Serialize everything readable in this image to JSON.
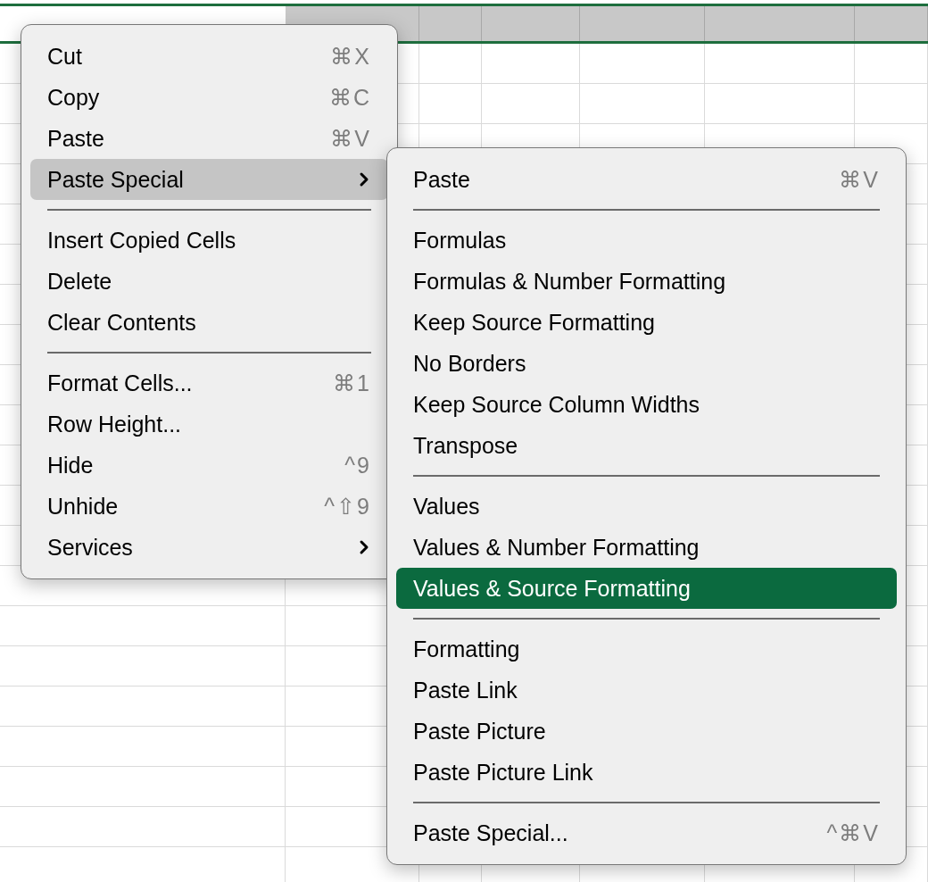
{
  "context_menu": {
    "groups": [
      {
        "items": [
          {
            "label": "Cut",
            "shortcut": "⌘X",
            "has_submenu": false,
            "selected": false
          },
          {
            "label": "Copy",
            "shortcut": "⌘C",
            "has_submenu": false,
            "selected": false
          },
          {
            "label": "Paste",
            "shortcut": "⌘V",
            "has_submenu": false,
            "selected": false
          },
          {
            "label": "Paste Special",
            "has_submenu": true,
            "selected": true
          }
        ]
      },
      {
        "items": [
          {
            "label": "Insert Copied Cells",
            "has_submenu": false,
            "selected": false
          },
          {
            "label": "Delete",
            "has_submenu": false,
            "selected": false
          },
          {
            "label": "Clear Contents",
            "has_submenu": false,
            "selected": false
          }
        ]
      },
      {
        "items": [
          {
            "label": "Format Cells...",
            "shortcut": "⌘1",
            "has_submenu": false,
            "selected": false
          },
          {
            "label": "Row Height...",
            "has_submenu": false,
            "selected": false
          },
          {
            "label": "Hide",
            "shortcut": "^9",
            "has_submenu": false,
            "selected": false
          },
          {
            "label": "Unhide",
            "shortcut": "^⇧9",
            "has_submenu": false,
            "selected": false
          },
          {
            "label": "Services",
            "has_submenu": true,
            "selected": false
          }
        ]
      }
    ]
  },
  "submenu": {
    "groups": [
      {
        "items": [
          {
            "label": "Paste",
            "shortcut": "⌘V",
            "selected": false
          }
        ]
      },
      {
        "items": [
          {
            "label": "Formulas",
            "selected": false
          },
          {
            "label": "Formulas & Number Formatting",
            "selected": false
          },
          {
            "label": "Keep Source Formatting",
            "selected": false
          },
          {
            "label": "No Borders",
            "selected": false
          },
          {
            "label": "Keep Source Column Widths",
            "selected": false
          },
          {
            "label": "Transpose",
            "selected": false
          }
        ]
      },
      {
        "items": [
          {
            "label": "Values",
            "selected": false
          },
          {
            "label": "Values & Number Formatting",
            "selected": false
          },
          {
            "label": "Values & Source Formatting",
            "selected": true
          }
        ]
      },
      {
        "items": [
          {
            "label": "Formatting",
            "selected": false
          },
          {
            "label": "Paste Link",
            "selected": false
          },
          {
            "label": "Paste Picture",
            "selected": false
          },
          {
            "label": "Paste Picture Link",
            "selected": false
          }
        ]
      },
      {
        "items": [
          {
            "label": "Paste Special...",
            "shortcut": "^⌘V",
            "selected": false
          }
        ]
      }
    ]
  }
}
